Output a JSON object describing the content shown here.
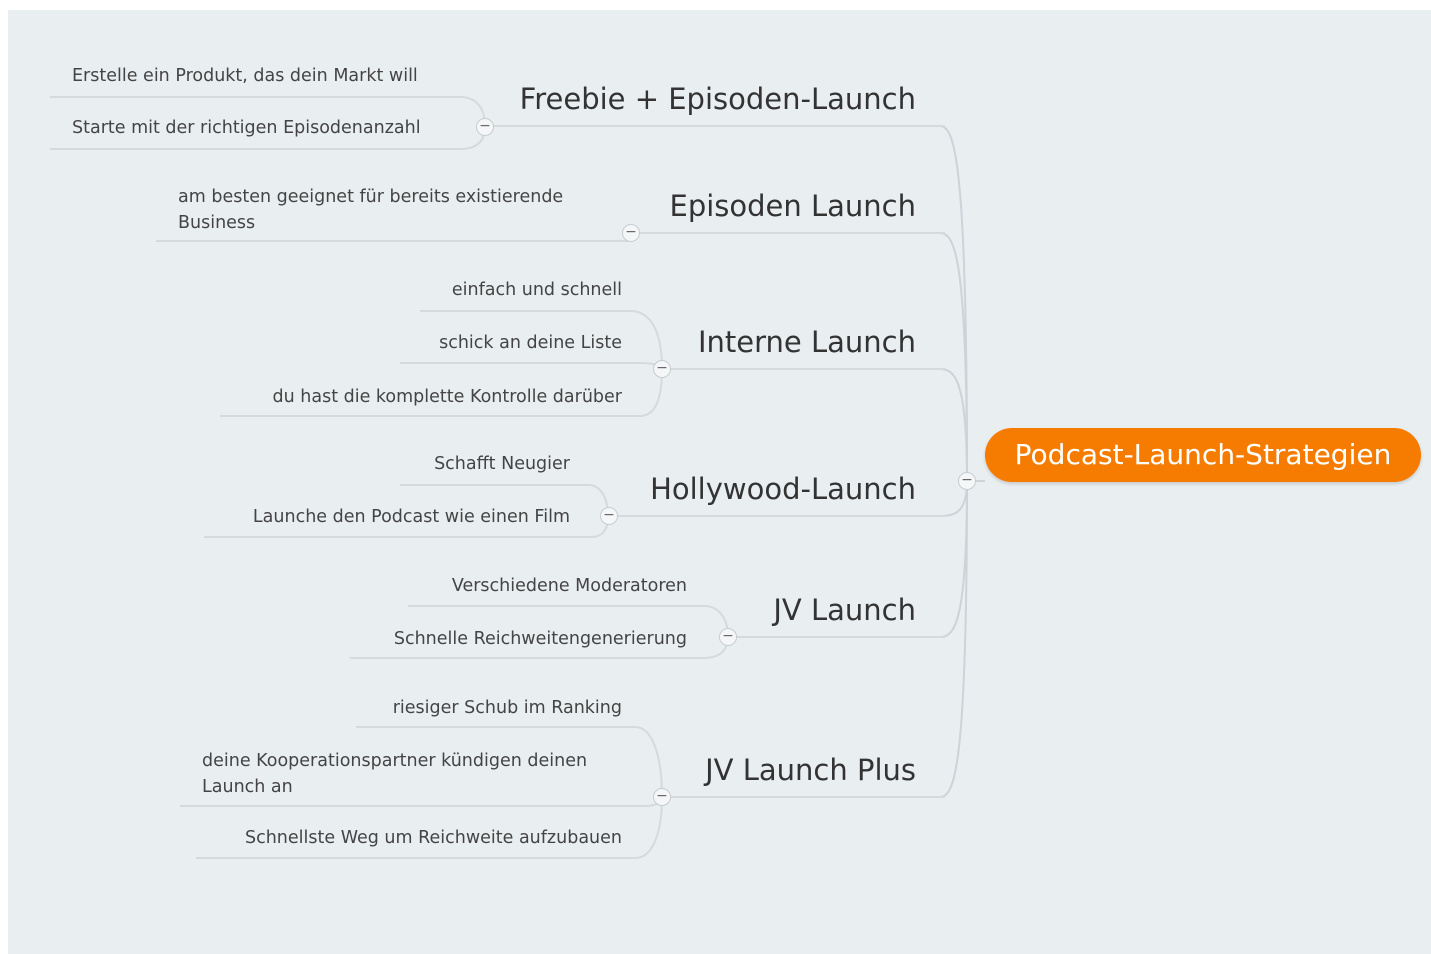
{
  "colors": {
    "root_fill": "#f57c00",
    "connector": "#cdd3d7",
    "underline": "#d5dadd"
  },
  "mindmap": {
    "root": {
      "label": "Podcast-Launch-Strategien"
    },
    "branches": [
      {
        "label": "Freebie + Episoden-Launch",
        "children": [
          "Erstelle ein Produkt, das dein Markt will",
          "Starte mit der richtigen Episodenanzahl"
        ]
      },
      {
        "label": "Episoden Launch",
        "children": [
          "am besten geeignet für bereits existierende Business"
        ]
      },
      {
        "label": "Interne Launch",
        "children": [
          "einfach und schnell",
          "schick an deine Liste",
          "du hast die komplette Kontrolle darüber"
        ]
      },
      {
        "label": "Hollywood-Launch",
        "children": [
          "Schafft Neugier",
          "Launche den Podcast wie einen Film"
        ]
      },
      {
        "label": "JV Launch",
        "children": [
          "Verschiedene Moderatoren",
          "Schnelle Reichweitengenerierung"
        ]
      },
      {
        "label": "JV Launch Plus",
        "children": [
          "riesiger Schub im Ranking",
          "deine Kooperationspartner kündigen deinen Launch an",
          "Schnellste Weg um Reichweite aufzubauen"
        ]
      }
    ]
  }
}
